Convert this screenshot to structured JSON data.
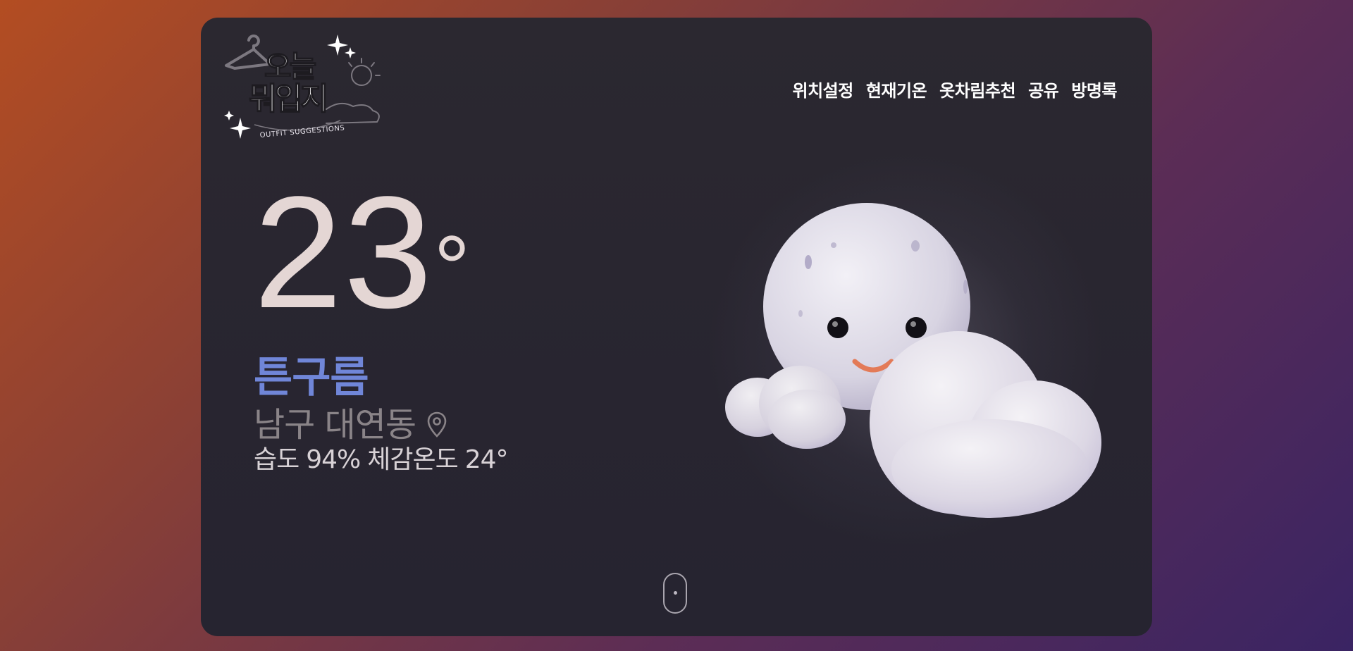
{
  "logo": {
    "title_line1": "오늘",
    "title_line2": "뭐입지",
    "tagline": "OUTFIT SUGGESTIONS"
  },
  "nav": {
    "items": [
      {
        "label": "위치설정"
      },
      {
        "label": "현재기온"
      },
      {
        "label": "옷차림추천"
      },
      {
        "label": "공유"
      },
      {
        "label": "방명록"
      }
    ]
  },
  "weather": {
    "temperature": "23",
    "degree_symbol": "°",
    "condition": "튼구름",
    "location": "남구 대연동",
    "humidity_label": "습도",
    "humidity_value": "94%",
    "feels_like_label": "체감온도",
    "feels_like_value": "24°",
    "illustration": "moon-with-clouds"
  },
  "icons": {
    "location": "map-pin-icon",
    "scroll": "mouse-scroll-icon"
  },
  "colors": {
    "temperature": "#e4d6d4",
    "condition": "#7086d8",
    "location": "#8a8488",
    "details": "#d8d2d6",
    "card_background": "#2a2730"
  }
}
